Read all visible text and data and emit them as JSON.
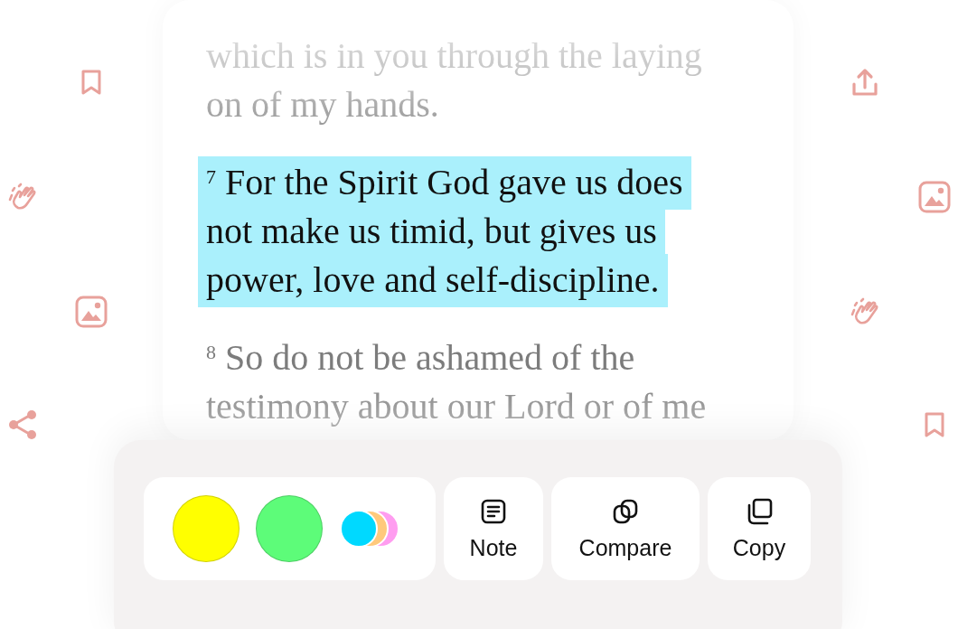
{
  "verses": [
    {
      "lines": [
        "which is in you through the laying",
        "on of my hands."
      ],
      "highlighted": false
    },
    {
      "number": "7",
      "lines": [
        "For the Spirit God gave us does",
        "not make us timid, but gives us",
        "power, love and self-discipline."
      ],
      "highlighted": true
    },
    {
      "number": "8",
      "lines": [
        "So do not be ashamed of the",
        "testimony about our Lord or of me"
      ],
      "highlighted": false
    }
  ],
  "colors": [
    {
      "kind": "swatch",
      "color": "#ffff00"
    },
    {
      "kind": "swatch",
      "color": "#5dfc79"
    },
    {
      "kind": "more"
    }
  ],
  "actions": [
    {
      "kind": "note",
      "label": "Note"
    },
    {
      "kind": "compare",
      "label": "Compare"
    },
    {
      "kind": "copy",
      "label": "Copy"
    }
  ],
  "left_icons": [
    {
      "kind": "bookmark"
    },
    {
      "kind": "clap"
    },
    {
      "kind": "image"
    },
    {
      "kind": "share"
    }
  ],
  "right_icons": [
    {
      "kind": "upload"
    },
    {
      "kind": "image"
    },
    {
      "kind": "clap"
    },
    {
      "kind": "bookmark"
    }
  ]
}
